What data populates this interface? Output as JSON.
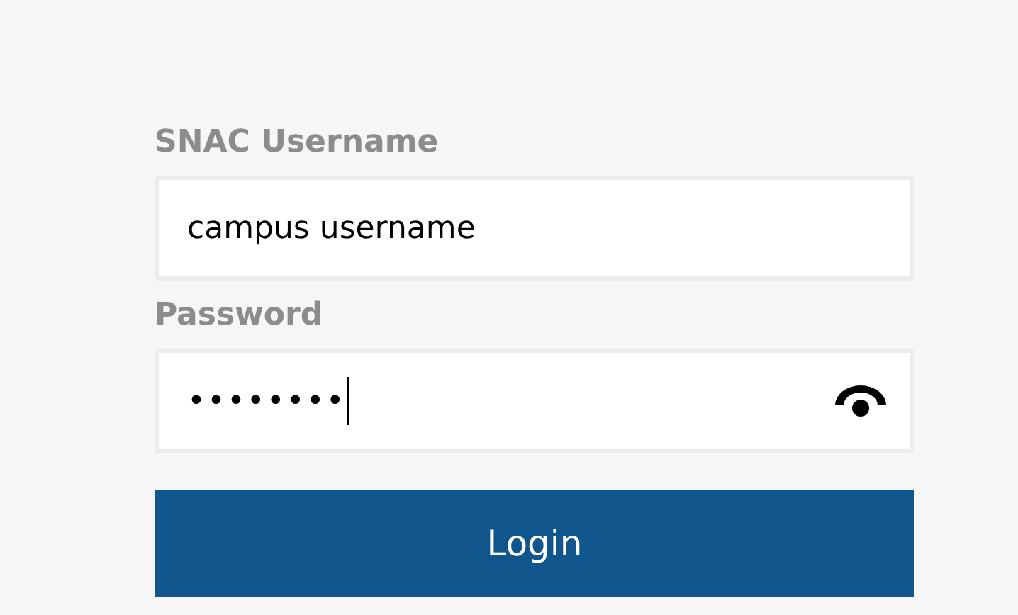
{
  "form": {
    "fields": [
      {
        "label": "SNAC Username",
        "kind": "text",
        "value": "campus username"
      },
      {
        "label": "Password",
        "kind": "password",
        "value": "••••••••",
        "focused": true
      }
    ],
    "submit": {
      "label": "Login"
    }
  }
}
